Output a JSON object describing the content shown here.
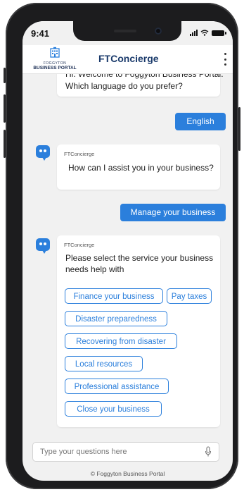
{
  "status_bar": {
    "time": "9:41"
  },
  "header": {
    "logo_top": "FOGGYTON",
    "logo_bottom": "BUSINESS PORTAL",
    "title": "FTConcierge",
    "menu_icon": "kebab-menu-icon"
  },
  "messages": {
    "bot1": {
      "partial_line": "Hi. Welcome to Foggyton Business Portal.",
      "text": "Which language do you prefer?"
    },
    "user1": "English",
    "bot2": {
      "sender": "FTConcierge",
      "text": "How can I assist you in your business?"
    },
    "user2": "Manage your business",
    "bot3": {
      "sender": "FTConcierge",
      "text_line1": "Please select the service your business",
      "text_line2": "needs help with",
      "options": [
        "Finance your business",
        "Pay taxes",
        "Disaster preparedness",
        "Recovering from disaster",
        "Local resources",
        "Professional assistance",
        "Close your business"
      ]
    }
  },
  "input": {
    "placeholder": "Type your questions here",
    "value": "",
    "icon": "microphone-icon"
  },
  "footer": "© Foggyton Business Portal",
  "colors": {
    "accent": "#2b7fdc",
    "header_title": "#1a3a6b",
    "background": "#f1f1f1"
  }
}
